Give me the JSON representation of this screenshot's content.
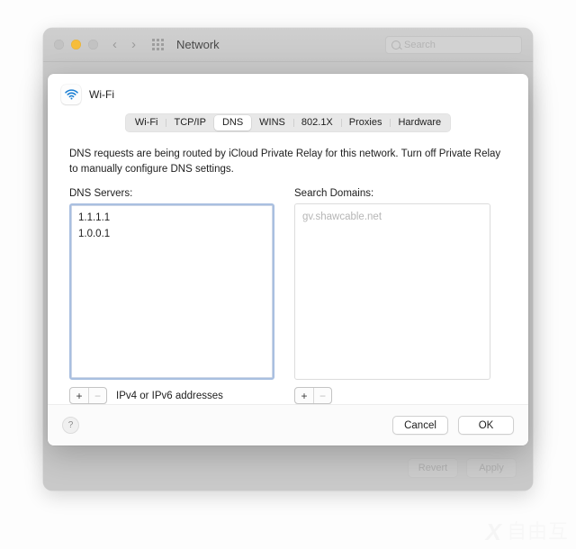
{
  "window": {
    "title": "Network",
    "traffic_lights": [
      "close",
      "minimize",
      "zoom"
    ],
    "nav_back": "‹",
    "nav_forward": "›",
    "grid_icon": "grid-icon",
    "search": {
      "placeholder": "Search",
      "value": ""
    },
    "background_buttons": {
      "revert": "Revert",
      "apply": "Apply"
    }
  },
  "sheet": {
    "service_icon": "wifi-icon",
    "service_name": "Wi-Fi",
    "tabs": [
      {
        "label": "Wi-Fi",
        "selected": false
      },
      {
        "label": "TCP/IP",
        "selected": false
      },
      {
        "label": "DNS",
        "selected": true
      },
      {
        "label": "WINS",
        "selected": false
      },
      {
        "label": "802.1X",
        "selected": false
      },
      {
        "label": "Proxies",
        "selected": false
      },
      {
        "label": "Hardware",
        "selected": false
      }
    ],
    "info_text": "DNS requests are being routed by iCloud Private Relay for this network. Turn off Private Relay to manually configure DNS settings.",
    "dns_servers": {
      "label": "DNS Servers:",
      "entries": [
        "1.1.1.1",
        "1.0.0.1"
      ],
      "add_label": "+",
      "remove_label": "−",
      "hint": "IPv4 or IPv6 addresses"
    },
    "search_domains": {
      "label": "Search Domains:",
      "entries": [
        "gv.shawcable.net"
      ],
      "add_label": "+",
      "remove_label": "−"
    },
    "footer": {
      "help_label": "?",
      "cancel_label": "Cancel",
      "ok_label": "OK"
    }
  },
  "watermark": {
    "logo": "X",
    "text": "自由互"
  },
  "colors": {
    "accent_blue": "#1a7fd4",
    "focus_ring": "#a9bfe0",
    "window_gray": "#c9c9c9",
    "amber": "#f6bd3b"
  }
}
